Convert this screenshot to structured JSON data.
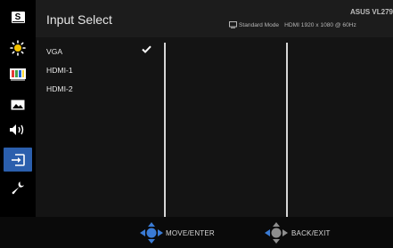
{
  "header": {
    "title": "Input Select",
    "model": "ASUS VL279",
    "mode": "Standard Mode",
    "signal": "HDMI 1920 x 1080 @ 60Hz"
  },
  "sidebar": {
    "items": [
      {
        "icon": "s-icon",
        "label": "S"
      },
      {
        "icon": "brightness-icon"
      },
      {
        "icon": "color-bars-icon"
      },
      {
        "icon": "image-icon"
      },
      {
        "icon": "speaker-icon"
      },
      {
        "icon": "input-select-icon",
        "active": true
      },
      {
        "icon": "wrench-icon"
      }
    ]
  },
  "inputs": {
    "options": [
      "VGA",
      "HDMI-1",
      "HDMI-2"
    ],
    "selected": "VGA"
  },
  "footer": {
    "move_label": "MOVE/ENTER",
    "back_label": "BACK/EXIT"
  },
  "colors": {
    "accent": "#2b5fad",
    "dpad_blue": "#3a7bd5",
    "header_bg": "#1c1c1c",
    "content_bg": "#141414"
  }
}
